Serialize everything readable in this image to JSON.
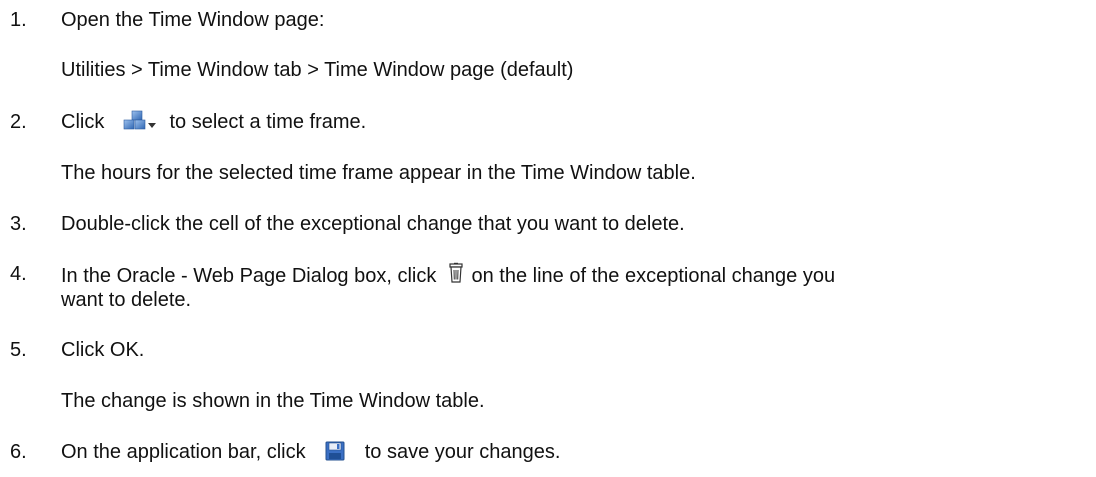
{
  "steps": [
    {
      "num": "1.",
      "text": "Open the Time Window page:",
      "detail": "Utilities > Time Window tab > Time Window page (default)"
    },
    {
      "num": "2.",
      "pre": "Click",
      "icon": "time-frame-selector-icon",
      "post": "to select a time frame.",
      "detail": "The hours for the selected time frame appear in the Time Window table."
    },
    {
      "num": "3.",
      "text": "Double-click the cell of the exceptional change that you want to delete."
    },
    {
      "num": "4.",
      "pre": "In the Oracle - Web Page Dialog box, click",
      "icon": "trash-icon",
      "post": "on the line of the exceptional change you",
      "post2": "want to delete."
    },
    {
      "num": "5.",
      "text": "Click OK.",
      "detail": "The change is shown in the Time Window table."
    },
    {
      "num": "6.",
      "pre": "On the application bar, click",
      "icon": "save-icon",
      "post": "to save your changes."
    }
  ]
}
